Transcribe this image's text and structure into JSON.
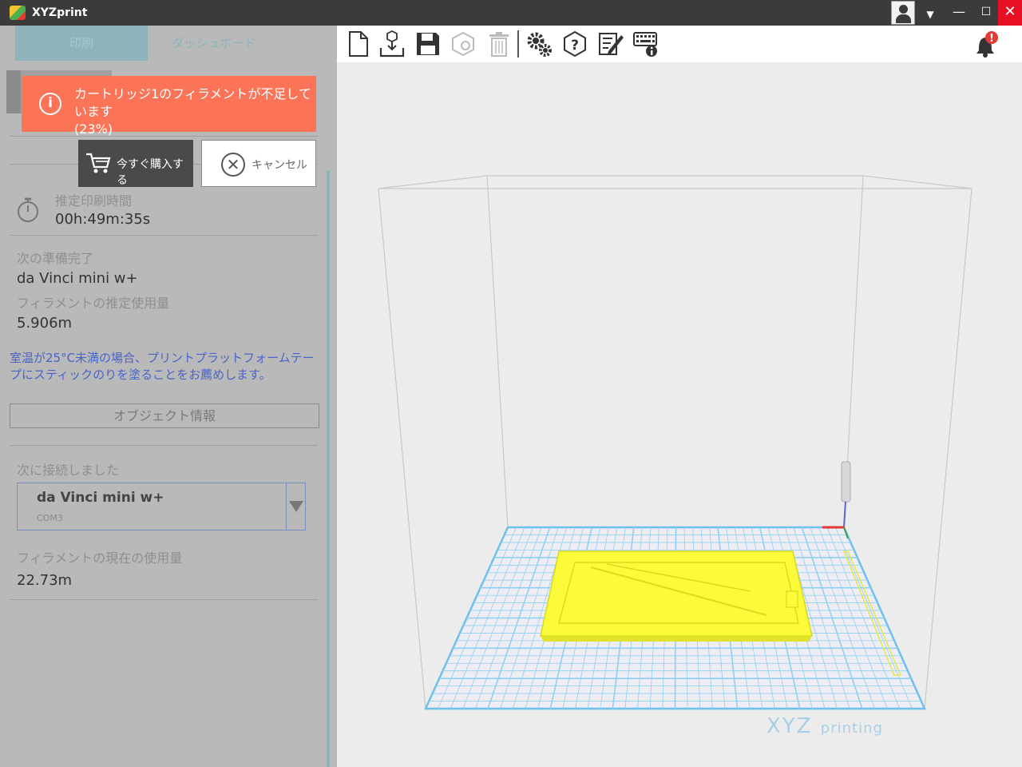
{
  "window": {
    "title": "XYZprint"
  },
  "tabs": {
    "print": "印刷",
    "dashboard": "ダッシュボード"
  },
  "toast": {
    "message": "カートリッジ1のフィラメントが不足しています",
    "percent": "(23%)",
    "icon": "info-icon"
  },
  "buttons": {
    "buy_now": "今すぐ購入する",
    "cancel": "キャンセル"
  },
  "print_info": {
    "est_time_label": "推定印刷時間",
    "est_time_value": "00h:49m:35s",
    "ready_label": "次の準備完了",
    "ready_value": "da Vinci mini w+",
    "est_filament_label": "フィラメントの推定使用量",
    "est_filament_value": "5.906m"
  },
  "hint": "室温が25°C未満の場合、プリントプラットフォームテープにスティックのりを塗ることをお薦めします。",
  "object_info_button": "オブジェクト情報",
  "connection": {
    "label": "次に接続しました",
    "printer_name": "da Vinci mini w+",
    "port": "COM3",
    "current_usage_label": "フィラメントの現在の使用量",
    "current_usage_value": "22.73m"
  },
  "toolbar_icons": [
    "new-file-icon",
    "import-icon",
    "save-icon",
    "object-icon",
    "trash-icon",
    "settings-icon",
    "help-icon",
    "notes-icon",
    "keyboard-info-icon"
  ],
  "viewport": {
    "brand": "XYZ",
    "brand_sub": "printing"
  },
  "colors": {
    "accent_teal": "#8fb3bb",
    "toast": "#fb7458",
    "model_yellow": "#ffff33",
    "grid_blue": "#6ec0ec",
    "close_red": "#e81123"
  }
}
